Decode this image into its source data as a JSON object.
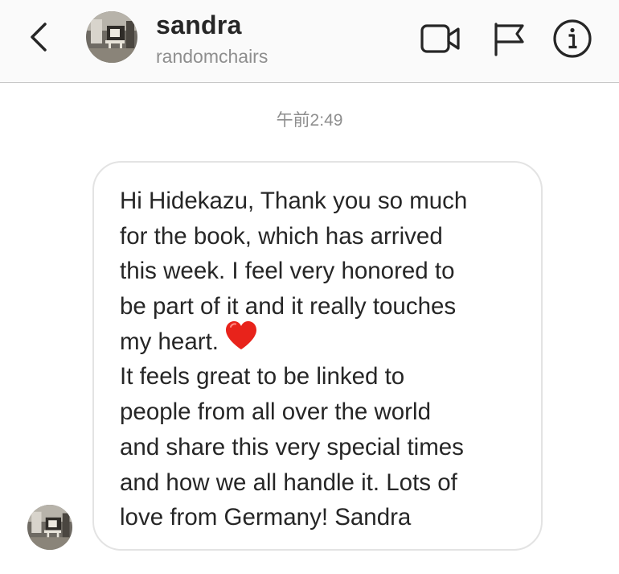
{
  "header": {
    "name": "sandra",
    "username": "randomchairs"
  },
  "conversation": {
    "timestamp": "午前2:49",
    "message": {
      "lines": [
        "Hi Hidekazu, Thank you so much",
        "for the book, which has arrived",
        "this week. I feel very honored to",
        "be part of it and it really touches",
        "my heart.",
        "It feels great to be linked to",
        "people from all over the world",
        "and share this very special times",
        "and how we all handle it. Lots of",
        "love from Germany! Sandra"
      ],
      "emoji": "red-heart"
    }
  },
  "icons": {
    "back": "chevron-left-icon",
    "video": "video-camera-icon",
    "flag": "flag-icon",
    "info": "info-icon"
  },
  "colors": {
    "header_bg": "#fafafa",
    "secondary_text": "#8e8e8e",
    "bubble_border": "#e3e3e3",
    "heart": "#e8231b"
  }
}
